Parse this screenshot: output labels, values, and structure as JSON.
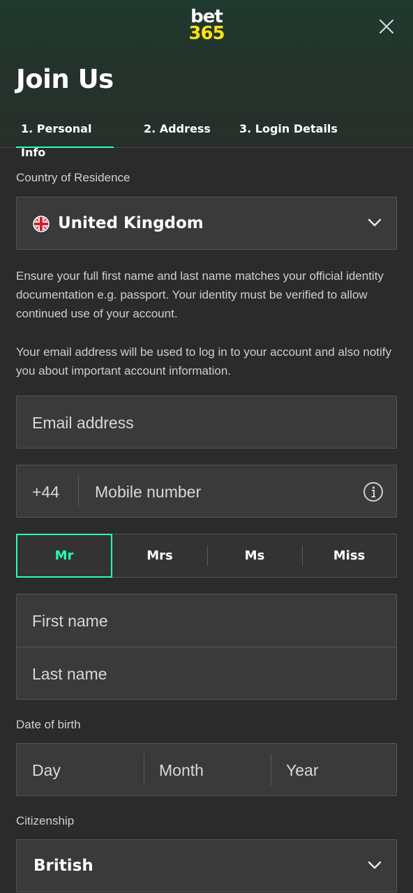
{
  "brand": {
    "logo_top": "bet",
    "logo_bottom": "365"
  },
  "header": {
    "title": "Join Us"
  },
  "tabs": [
    {
      "label": "1.  Personal Info",
      "active": true
    },
    {
      "label": "2.  Address",
      "active": false
    },
    {
      "label": "3.  Login Details",
      "active": false
    }
  ],
  "country": {
    "label": "Country of Residence",
    "value": "United Kingdom"
  },
  "info": {
    "identity": "Ensure your full first name and last name matches your official identity documentation e.g. passport. Your identity must be verified to allow continued use of your account.",
    "email_note": "Your email address will be used to log in to your account and also notify you about important account information."
  },
  "email": {
    "placeholder": "Email address"
  },
  "phone": {
    "prefix": "+44",
    "placeholder": "Mobile number"
  },
  "titles": {
    "options": [
      "Mr",
      "Mrs",
      "Ms",
      "Miss"
    ],
    "selected": "Mr"
  },
  "name": {
    "first_placeholder": "First name",
    "last_placeholder": "Last name"
  },
  "dob": {
    "label": "Date of birth",
    "day": "Day",
    "month": "Month",
    "year": "Year"
  },
  "citizenship": {
    "label": "Citizenship",
    "value": "British"
  },
  "colors": {
    "accent": "#26ffbe",
    "brand_yellow": "#ffdf1b"
  }
}
